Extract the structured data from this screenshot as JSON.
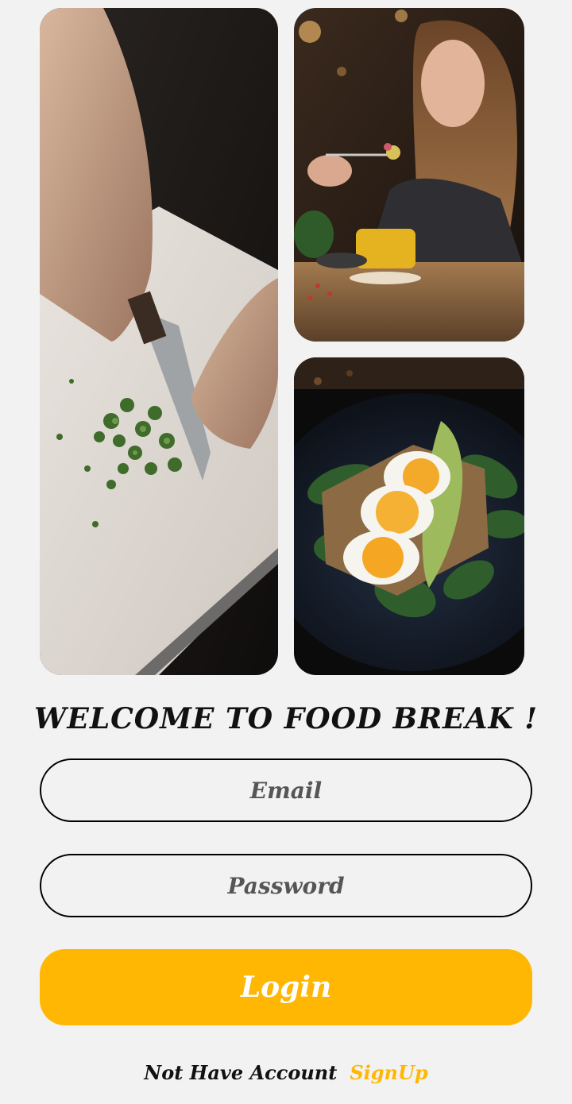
{
  "images": {
    "chopping": "chopping-vegetables-photo",
    "dining": "woman-eating-photo",
    "eggs": "egg-toast-photo"
  },
  "welcome": {
    "title": "WELCOME TO FOOD BREAK !"
  },
  "form": {
    "email_placeholder": "Email",
    "password_placeholder": "Password",
    "login_label": "Login"
  },
  "footer": {
    "question": "Not Have Account",
    "signup_label": "SignUp"
  },
  "colors": {
    "background": "#f2f2f2",
    "accent": "#ffb703",
    "text": "#111111"
  }
}
